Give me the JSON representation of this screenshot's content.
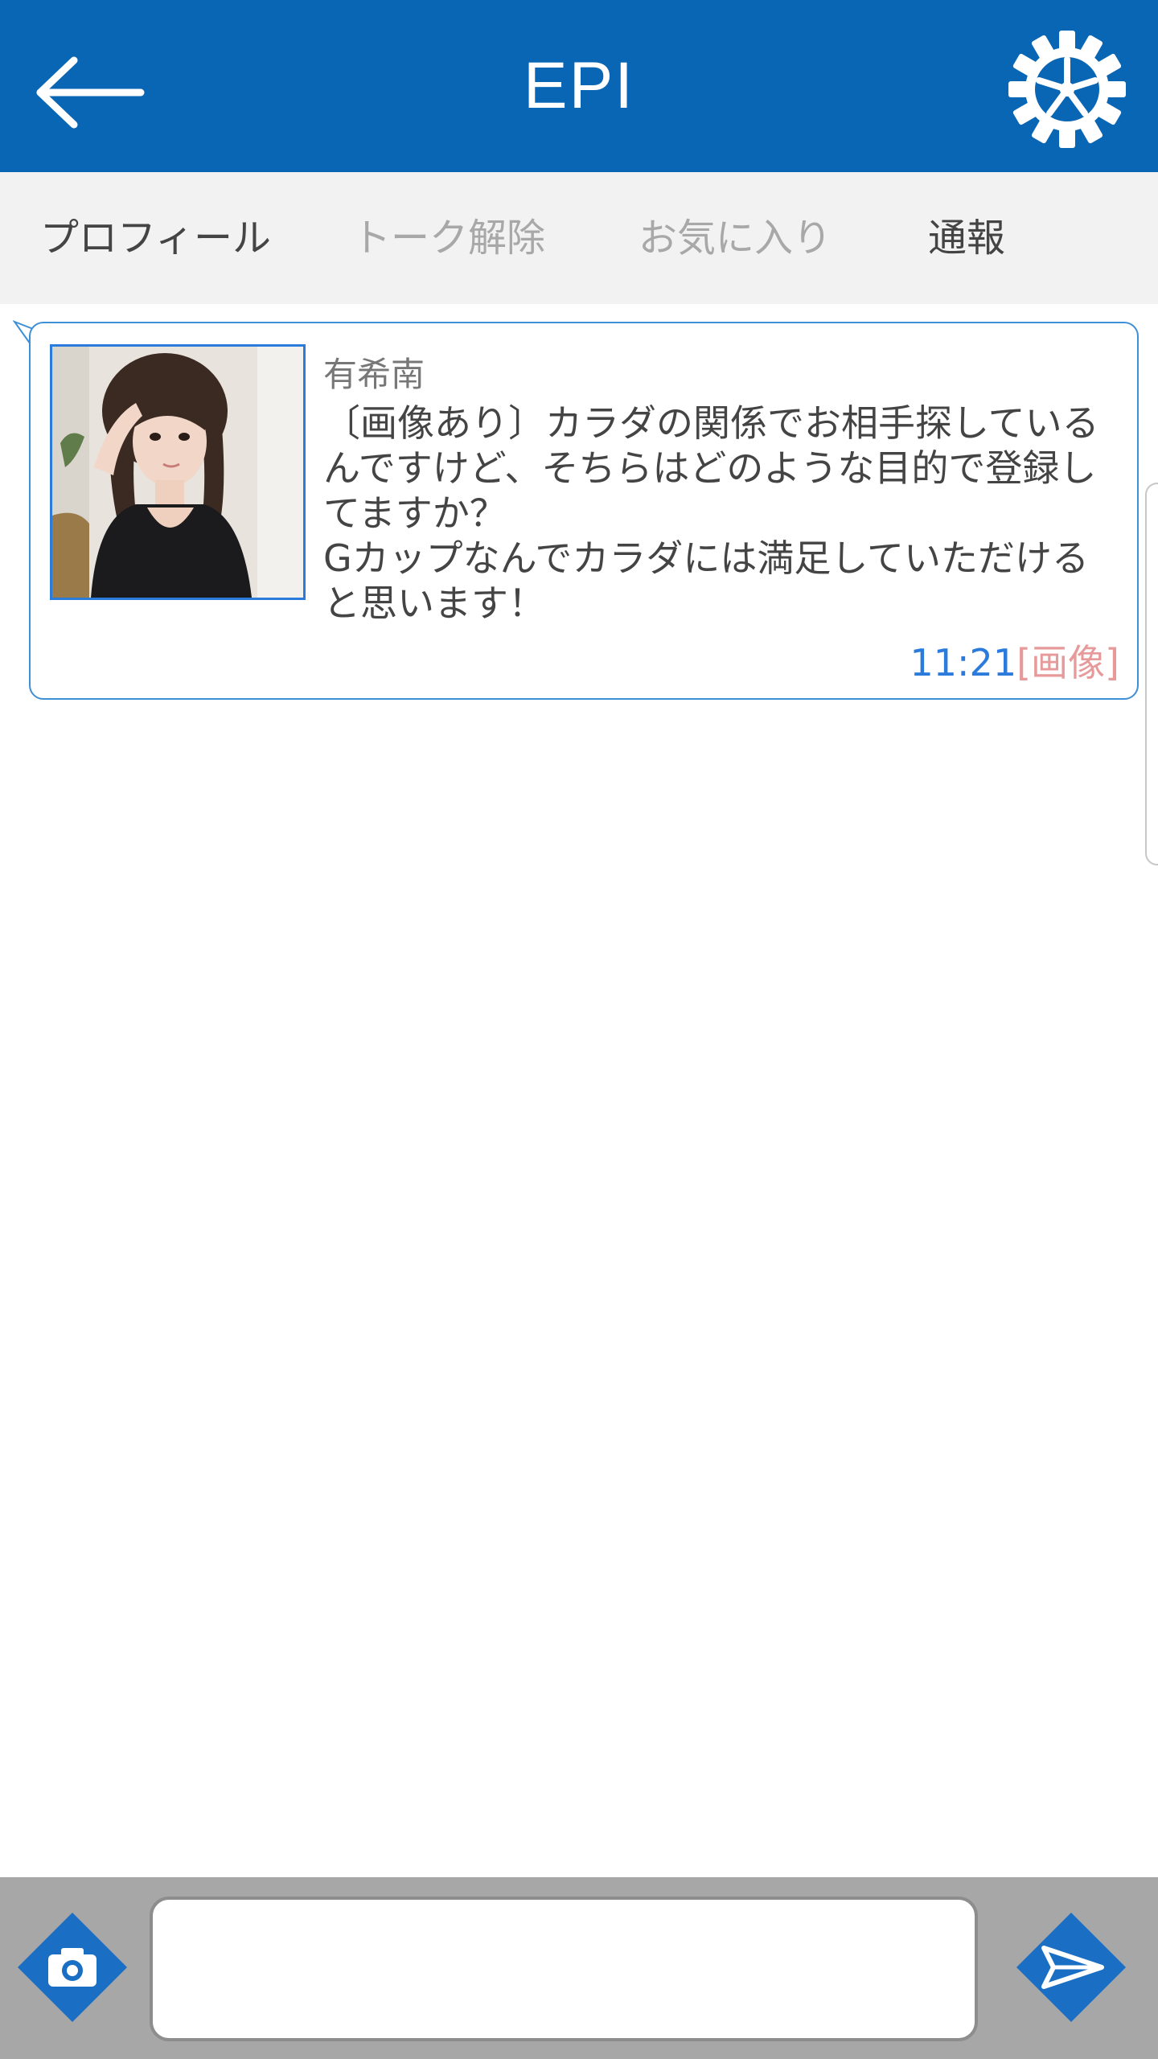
{
  "header": {
    "title": "EPI",
    "back_icon": "arrow-left-icon",
    "settings_icon": "gear-icon",
    "background_color": "#0866b4"
  },
  "tabs": [
    {
      "label": "プロフィール",
      "state": "active"
    },
    {
      "label": "トーク解除",
      "state": "disabled"
    },
    {
      "label": "お気に入り",
      "state": "disabled"
    },
    {
      "label": "通報",
      "state": "active"
    }
  ],
  "message": {
    "sender": "有希南",
    "lines": [
      "〔画像あり〕カラダの関係でお相手探している",
      "んですけど、そちらはどのような目的で登録し",
      "てますか？",
      "Gカップなんでカラダには満足していただける",
      "と思います！"
    ],
    "time": "11:21",
    "image_tag": "[画像]",
    "border_color": "#3d8fd6"
  },
  "input_bar": {
    "text_value": "",
    "camera_icon": "camera-icon",
    "send_icon": "send-icon",
    "button_color": "#1a6fc4"
  }
}
